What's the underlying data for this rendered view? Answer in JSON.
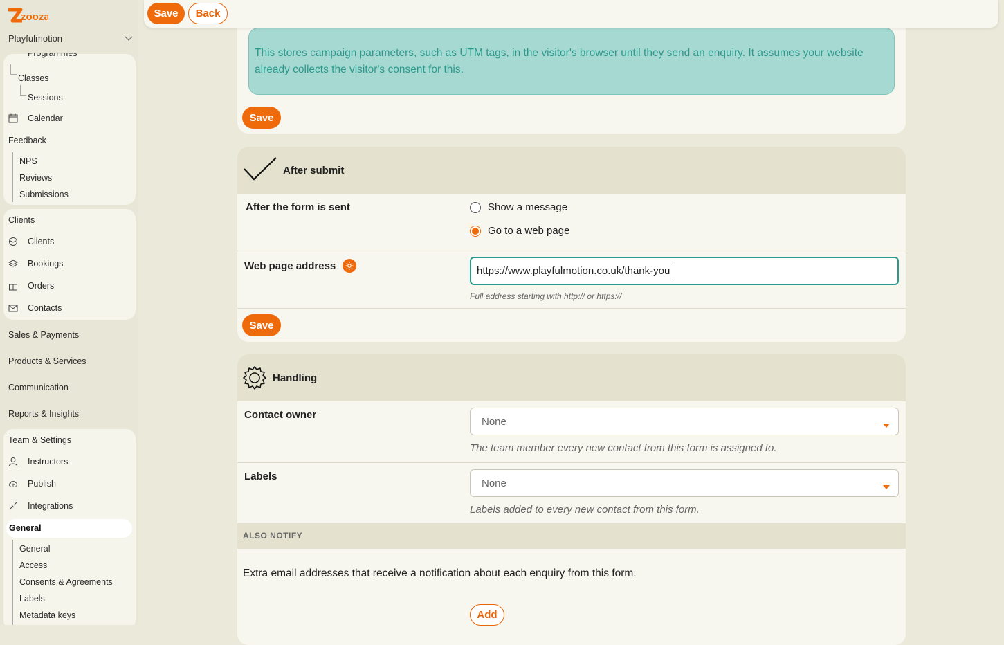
{
  "app": {
    "logo": "zooza",
    "account": "Playfulmotion"
  },
  "sidebar": {
    "programmes_label": "Programmes",
    "classes_label": "Classes",
    "sessions_label": "Sessions",
    "calendar_label": "Calendar",
    "feedback": {
      "title": "Feedback",
      "items": [
        "NPS",
        "Reviews",
        "Submissions"
      ]
    },
    "clients": {
      "title": "Clients",
      "items": [
        "Clients",
        "Bookings",
        "Orders",
        "Contacts"
      ]
    },
    "sales": "Sales & Payments",
    "products": "Products & Services",
    "communication": "Communication",
    "reports": "Reports & Insights",
    "team": {
      "title": "Team & Settings",
      "items": [
        "Instructors",
        "Publish",
        "Integrations"
      ]
    },
    "general": {
      "title": "General",
      "items": [
        "General",
        "Access",
        "Consents & Agreements",
        "Labels",
        "Metadata keys"
      ]
    }
  },
  "toolbar": {
    "save_label": "Save",
    "back_label": "Back"
  },
  "campaign": {
    "info": "This stores campaign parameters, such as UTM tags, in the visitor's browser until they send an enquiry. It assumes your website already collects the visitor's consent for this.",
    "save_label": "Save"
  },
  "after_submit": {
    "title": "After submit",
    "form_sent_label": "After the form is sent",
    "options": [
      "Show a message",
      "Go to a web page"
    ],
    "selected": "Go to a web page",
    "web_address_label": "Web page address",
    "web_address_value": "https://www.playfulmotion.co.uk/thank-you",
    "web_address_hint": "Full address starting with http:// or https://",
    "save_label": "Save"
  },
  "handling": {
    "title": "Handling",
    "contact_owner_label": "Contact owner",
    "contact_owner_value": "None",
    "contact_owner_hint": "The team member every new contact from this form is assigned to.",
    "labels_label": "Labels",
    "labels_value": "None",
    "labels_hint": "Labels added to every new contact from this form.",
    "also_notify_title": "ALSO NOTIFY",
    "also_notify_text": "Extra email addresses that receive a notification about each enquiry from this form.",
    "add_label": "Add"
  },
  "colors": {
    "accent": "#ef6a0a",
    "info_bg": "#a7d9d3",
    "info_text": "#2a9a8c"
  }
}
